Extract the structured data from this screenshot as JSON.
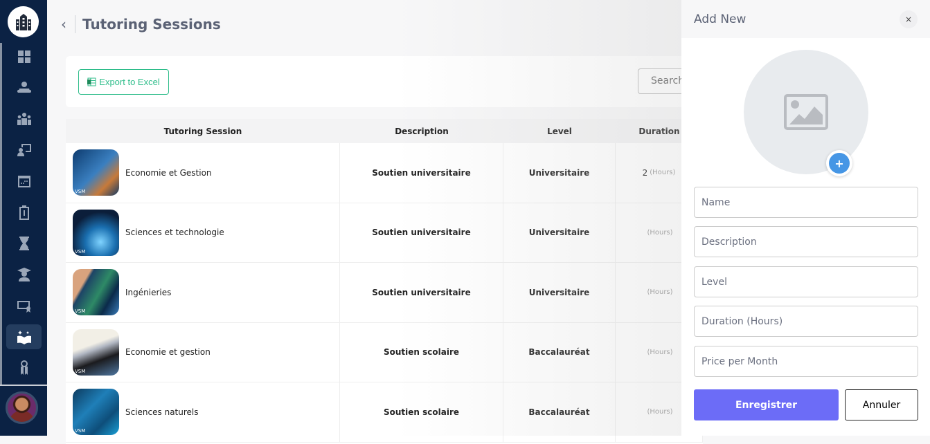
{
  "sidebar": {
    "items": [
      {
        "icon": "dashboard-icon"
      },
      {
        "icon": "reading-student-icon"
      },
      {
        "icon": "group-icon"
      },
      {
        "icon": "teacher-board-icon"
      },
      {
        "icon": "calendar-icon"
      },
      {
        "icon": "invoice-icon"
      },
      {
        "icon": "hourglass-icon"
      },
      {
        "icon": "graduate-icon"
      },
      {
        "icon": "certificate-icon"
      },
      {
        "icon": "tutoring-book-icon",
        "active": true
      },
      {
        "icon": "keys-icon"
      }
    ]
  },
  "header": {
    "back": "‹",
    "title": "Tutoring Sessions"
  },
  "toolbar": {
    "export_label": "Export to Excel",
    "search_placeholder": "Search"
  },
  "table": {
    "columns": [
      "Tutoring Session",
      "Description",
      "Level",
      "Duration"
    ],
    "unit": "(Hours)",
    "rows": [
      {
        "name": "Economie et Gestion",
        "description": "Soutien universitaire",
        "level": "Universitaire",
        "duration": "2",
        "badge": "VSM"
      },
      {
        "name": "Sciences et technologie",
        "description": "Soutien universitaire",
        "level": "Universitaire",
        "duration": "",
        "badge": "VSM"
      },
      {
        "name": "Ingénieries",
        "description": "Soutien universitaire",
        "level": "Universitaire",
        "duration": "",
        "badge": "VSM"
      },
      {
        "name": "Economie et gestion",
        "description": "Soutien scolaire",
        "level": "Baccalauréat",
        "duration": "",
        "badge": "VSM"
      },
      {
        "name": "Sciences naturels",
        "description": "Soutien scolaire",
        "level": "Baccalauréat",
        "duration": "",
        "badge": "VSM"
      }
    ]
  },
  "panel": {
    "title": "Add New",
    "close": "×",
    "plus": "+",
    "fields": [
      "Name",
      "Description",
      "Level",
      "Duration (Hours)",
      "Price per Month"
    ],
    "save_label": "Enregistrer",
    "cancel_label": "Annuler"
  },
  "colors": {
    "sidebar": "#0b2244",
    "accent": "#6c6cf7",
    "export": "#2ebd8a",
    "upload": "#4696e5"
  }
}
